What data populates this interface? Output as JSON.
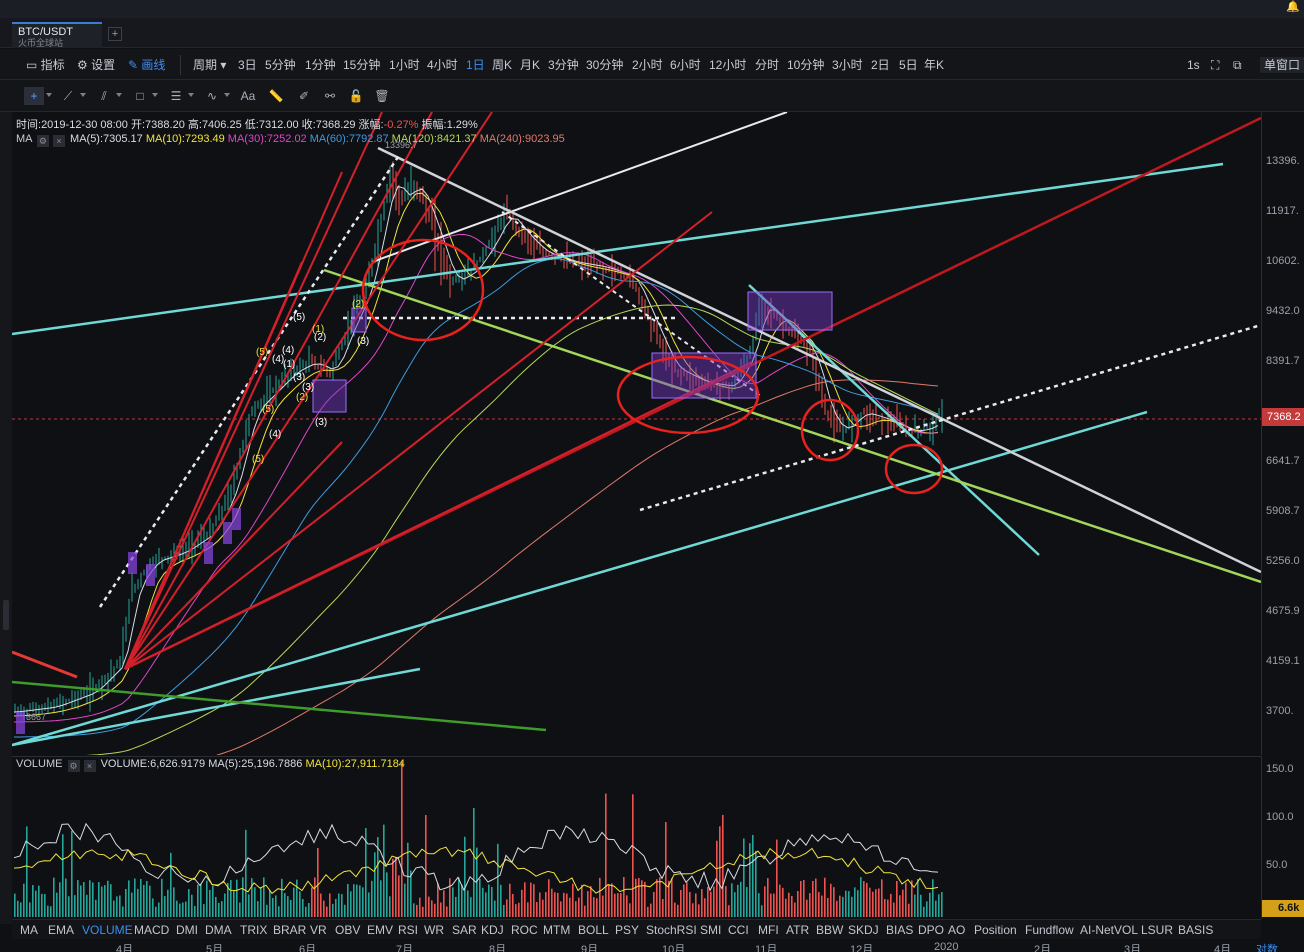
{
  "symbol": {
    "pair": "BTC/USDT",
    "exchange": "火币全球站",
    "add_tab": "+"
  },
  "toolbar": {
    "indicators": "指标",
    "settings": "设置",
    "draw": "画线",
    "period_label": "周期",
    "periods": [
      "3日",
      "5分钟",
      "1分钟",
      "15分钟",
      "1小时",
      "4小时",
      "1日",
      "周K",
      "月K",
      "3分钟",
      "30分钟",
      "2小时",
      "6小时",
      "12小时",
      "分时",
      "10分钟",
      "3小时",
      "2日",
      "5日",
      "年K"
    ],
    "active_period": "1日",
    "refresh": "1s",
    "window_mode": "单窗口"
  },
  "ohlc": {
    "time_label": "时间:",
    "time": "2019-12-30 08:00",
    "open_label": "开:",
    "open": "7388.20",
    "high_label": "高:",
    "high": "7406.25",
    "low_label": "低:",
    "low": "7312.00",
    "close_label": "收:",
    "close": "7368.29",
    "change_label": "涨幅:",
    "change": "-0.27%",
    "amplitude_label": "振幅:",
    "amplitude": "1.29%"
  },
  "ma": {
    "label": "MA",
    "items": [
      {
        "text": "MA(5):7305.17",
        "color": "#d8dce3"
      },
      {
        "text": "MA(10):7293.49",
        "color": "#f2e33a"
      },
      {
        "text": "MA(30):7252.02",
        "color": "#e046c8"
      },
      {
        "text": "MA(60):7792.87",
        "color": "#3d9be0"
      },
      {
        "text": "MA(120):8421.37",
        "color": "#b7d956"
      },
      {
        "text": "MA(240):9023.95",
        "color": "#e07a6a"
      }
    ]
  },
  "price_axis": {
    "ticks": [
      "13396.",
      "11917.",
      "10602.",
      "9432.0",
      "8391.7",
      "7368.2",
      "6641.7",
      "5908.7",
      "5256.0",
      "4675.9",
      "4159.1",
      "3700."
    ],
    "current_price": "7368.2",
    "high_marker": "13396.7",
    "low_marker": "3667"
  },
  "volume": {
    "label": "VOLUME",
    "items": [
      {
        "text": "VOLUME:6,626.9179",
        "color": "#d8dce3"
      },
      {
        "text": "MA(5):25,196.7886",
        "color": "#d8dce3"
      },
      {
        "text": "MA(10):27,911.7184",
        "color": "#f2e33a"
      }
    ],
    "ticks": [
      "150.0",
      "100.0",
      "50.0"
    ],
    "current": "6.6k"
  },
  "indicator_tabs": [
    "MA",
    "EMA",
    "VOLUME",
    "MACD",
    "DMI",
    "DMA",
    "TRIX",
    "BRAR",
    "VR",
    "OBV",
    "EMV",
    "RSI",
    "WR",
    "SAR",
    "KDJ",
    "ROC",
    "MTM",
    "BOLL",
    "PSY",
    "StochRSI",
    "SMI",
    "CCI",
    "MFI",
    "ATR",
    "BBW",
    "SKDJ",
    "BIAS",
    "DPO",
    "AO",
    "Position",
    "Fundflow",
    "AI-NetVOL",
    "LSUR",
    "BASIS"
  ],
  "active_indicator": "VOLUME",
  "time_axis": [
    "4月",
    "5月",
    "6月",
    "7月",
    "8月",
    "9月",
    "10月",
    "11月",
    "12月",
    "2020",
    "2月",
    "3月",
    "4月"
  ],
  "scale_mode": "对数",
  "wave_labels": [
    "(5)",
    "(3)",
    "(4)",
    "(5)",
    "(4)",
    "(1)",
    "(2)",
    "(3)",
    "(5)",
    "(1)",
    "(2)",
    "(3)",
    "(2)",
    "(3)",
    "(4)",
    "(5)"
  ],
  "colors": {
    "up": "#26a69a",
    "down": "#ef5350",
    "accent": "#3f8ef0",
    "current_price": "#c23a3a"
  },
  "icons": [
    "bell-icon",
    "chart-indicator-icon",
    "gear-icon",
    "pencil-icon",
    "crosshair-icon",
    "trend-line-icon",
    "fork-icon",
    "rectangle-icon",
    "parallel-lines-icon",
    "wave-icon",
    "text-icon",
    "ruler-icon",
    "brush-icon",
    "pattern-icon",
    "lock-icon",
    "trash-icon",
    "fullscreen-icon",
    "popout-icon"
  ]
}
